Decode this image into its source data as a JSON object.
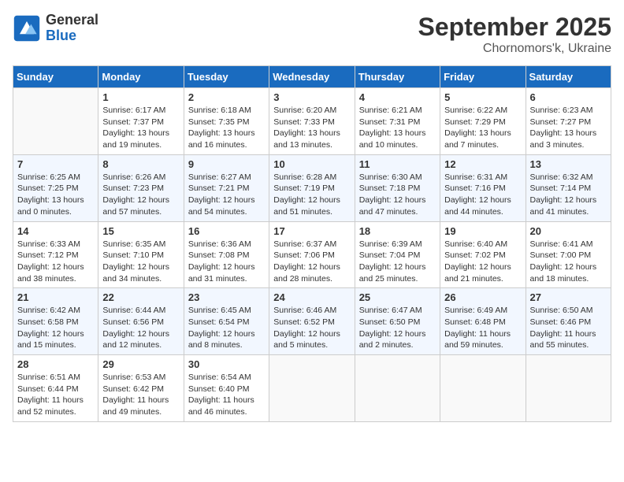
{
  "logo": {
    "general": "General",
    "blue": "Blue"
  },
  "header": {
    "month": "September 2025",
    "location": "Chornomors'k, Ukraine"
  },
  "weekdays": [
    "Sunday",
    "Monday",
    "Tuesday",
    "Wednesday",
    "Thursday",
    "Friday",
    "Saturday"
  ],
  "weeks": [
    [
      {
        "day": "",
        "info": ""
      },
      {
        "day": "1",
        "info": "Sunrise: 6:17 AM\nSunset: 7:37 PM\nDaylight: 13 hours\nand 19 minutes."
      },
      {
        "day": "2",
        "info": "Sunrise: 6:18 AM\nSunset: 7:35 PM\nDaylight: 13 hours\nand 16 minutes."
      },
      {
        "day": "3",
        "info": "Sunrise: 6:20 AM\nSunset: 7:33 PM\nDaylight: 13 hours\nand 13 minutes."
      },
      {
        "day": "4",
        "info": "Sunrise: 6:21 AM\nSunset: 7:31 PM\nDaylight: 13 hours\nand 10 minutes."
      },
      {
        "day": "5",
        "info": "Sunrise: 6:22 AM\nSunset: 7:29 PM\nDaylight: 13 hours\nand 7 minutes."
      },
      {
        "day": "6",
        "info": "Sunrise: 6:23 AM\nSunset: 7:27 PM\nDaylight: 13 hours\nand 3 minutes."
      }
    ],
    [
      {
        "day": "7",
        "info": "Sunrise: 6:25 AM\nSunset: 7:25 PM\nDaylight: 13 hours\nand 0 minutes."
      },
      {
        "day": "8",
        "info": "Sunrise: 6:26 AM\nSunset: 7:23 PM\nDaylight: 12 hours\nand 57 minutes."
      },
      {
        "day": "9",
        "info": "Sunrise: 6:27 AM\nSunset: 7:21 PM\nDaylight: 12 hours\nand 54 minutes."
      },
      {
        "day": "10",
        "info": "Sunrise: 6:28 AM\nSunset: 7:19 PM\nDaylight: 12 hours\nand 51 minutes."
      },
      {
        "day": "11",
        "info": "Sunrise: 6:30 AM\nSunset: 7:18 PM\nDaylight: 12 hours\nand 47 minutes."
      },
      {
        "day": "12",
        "info": "Sunrise: 6:31 AM\nSunset: 7:16 PM\nDaylight: 12 hours\nand 44 minutes."
      },
      {
        "day": "13",
        "info": "Sunrise: 6:32 AM\nSunset: 7:14 PM\nDaylight: 12 hours\nand 41 minutes."
      }
    ],
    [
      {
        "day": "14",
        "info": "Sunrise: 6:33 AM\nSunset: 7:12 PM\nDaylight: 12 hours\nand 38 minutes."
      },
      {
        "day": "15",
        "info": "Sunrise: 6:35 AM\nSunset: 7:10 PM\nDaylight: 12 hours\nand 34 minutes."
      },
      {
        "day": "16",
        "info": "Sunrise: 6:36 AM\nSunset: 7:08 PM\nDaylight: 12 hours\nand 31 minutes."
      },
      {
        "day": "17",
        "info": "Sunrise: 6:37 AM\nSunset: 7:06 PM\nDaylight: 12 hours\nand 28 minutes."
      },
      {
        "day": "18",
        "info": "Sunrise: 6:39 AM\nSunset: 7:04 PM\nDaylight: 12 hours\nand 25 minutes."
      },
      {
        "day": "19",
        "info": "Sunrise: 6:40 AM\nSunset: 7:02 PM\nDaylight: 12 hours\nand 21 minutes."
      },
      {
        "day": "20",
        "info": "Sunrise: 6:41 AM\nSunset: 7:00 PM\nDaylight: 12 hours\nand 18 minutes."
      }
    ],
    [
      {
        "day": "21",
        "info": "Sunrise: 6:42 AM\nSunset: 6:58 PM\nDaylight: 12 hours\nand 15 minutes."
      },
      {
        "day": "22",
        "info": "Sunrise: 6:44 AM\nSunset: 6:56 PM\nDaylight: 12 hours\nand 12 minutes."
      },
      {
        "day": "23",
        "info": "Sunrise: 6:45 AM\nSunset: 6:54 PM\nDaylight: 12 hours\nand 8 minutes."
      },
      {
        "day": "24",
        "info": "Sunrise: 6:46 AM\nSunset: 6:52 PM\nDaylight: 12 hours\nand 5 minutes."
      },
      {
        "day": "25",
        "info": "Sunrise: 6:47 AM\nSunset: 6:50 PM\nDaylight: 12 hours\nand 2 minutes."
      },
      {
        "day": "26",
        "info": "Sunrise: 6:49 AM\nSunset: 6:48 PM\nDaylight: 11 hours\nand 59 minutes."
      },
      {
        "day": "27",
        "info": "Sunrise: 6:50 AM\nSunset: 6:46 PM\nDaylight: 11 hours\nand 55 minutes."
      }
    ],
    [
      {
        "day": "28",
        "info": "Sunrise: 6:51 AM\nSunset: 6:44 PM\nDaylight: 11 hours\nand 52 minutes."
      },
      {
        "day": "29",
        "info": "Sunrise: 6:53 AM\nSunset: 6:42 PM\nDaylight: 11 hours\nand 49 minutes."
      },
      {
        "day": "30",
        "info": "Sunrise: 6:54 AM\nSunset: 6:40 PM\nDaylight: 11 hours\nand 46 minutes."
      },
      {
        "day": "",
        "info": ""
      },
      {
        "day": "",
        "info": ""
      },
      {
        "day": "",
        "info": ""
      },
      {
        "day": "",
        "info": ""
      }
    ]
  ]
}
